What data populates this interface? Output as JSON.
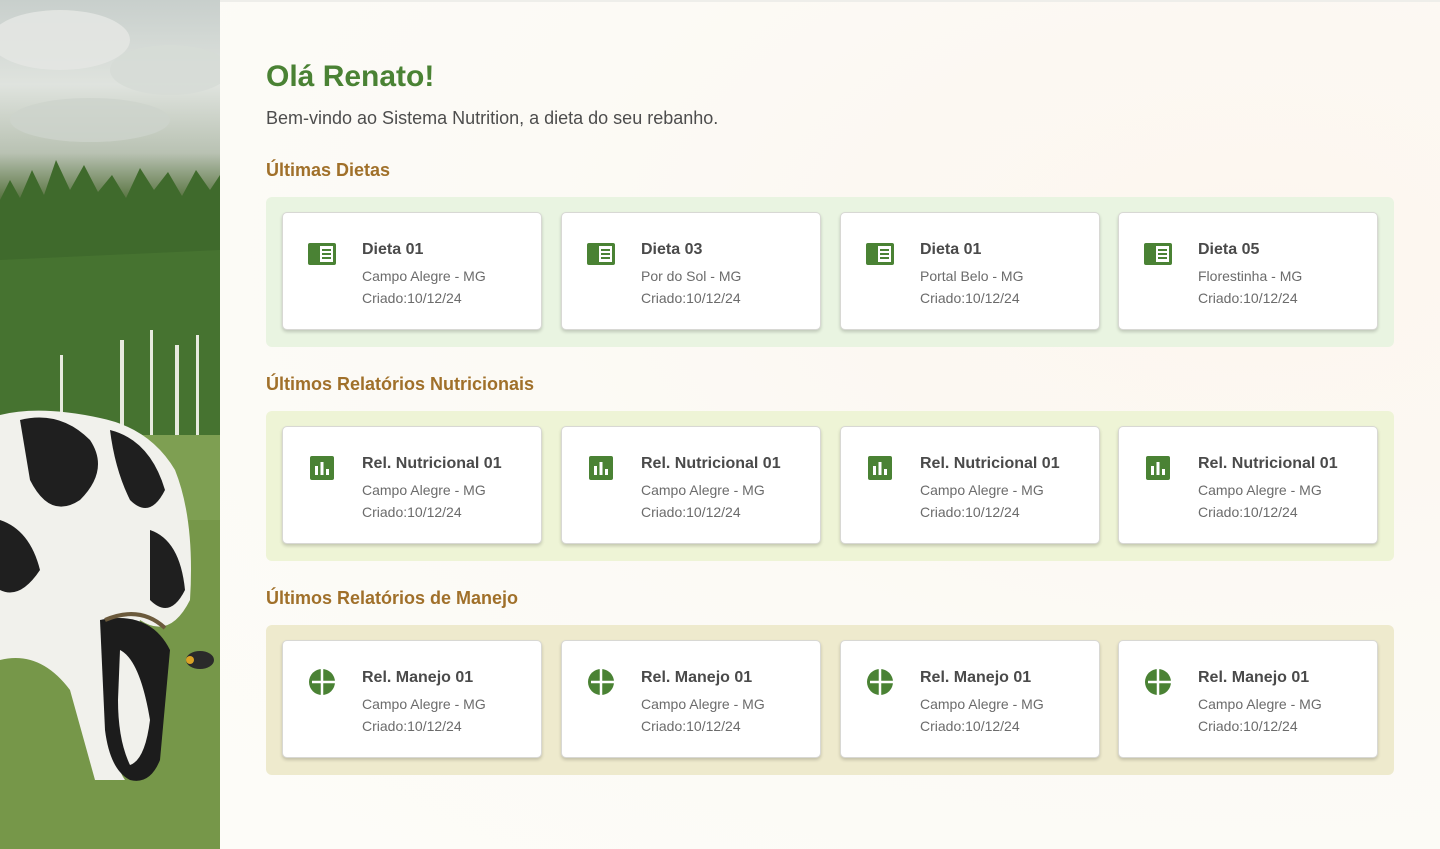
{
  "greeting": "Olá Renato!",
  "subtitle": "Bem-vindo ao Sistema Nutrition, a dieta do seu rebanho.",
  "colors": {
    "primary_green": "#4a8234",
    "section_title": "#a0702a",
    "panel_diets": "#e9f4e1",
    "panel_nutritional": "#eef4d6",
    "panel_management": "#eeeacd"
  },
  "sections": [
    {
      "title": "Últimas Dietas",
      "icon": "book-icon",
      "cards": [
        {
          "title": "Dieta 01",
          "location": "Campo Alegre - MG",
          "date": "Criado:10/12/24"
        },
        {
          "title": "Dieta 03",
          "location": "Por do Sol - MG",
          "date": "Criado:10/12/24"
        },
        {
          "title": "Dieta 01",
          "location": "Portal Belo - MG",
          "date": "Criado:10/12/24"
        },
        {
          "title": "Dieta 05",
          "location": "Florestinha - MG",
          "date": "Criado:10/12/24"
        }
      ]
    },
    {
      "title": "Últimos Relatórios Nutricionais",
      "icon": "bar-chart-icon",
      "cards": [
        {
          "title": "Rel. Nutricional 01",
          "location": "Campo Alegre - MG",
          "date": "Criado:10/12/24"
        },
        {
          "title": "Rel. Nutricional 01",
          "location": "Campo Alegre - MG",
          "date": "Criado:10/12/24"
        },
        {
          "title": "Rel. Nutricional 01",
          "location": "Campo Alegre - MG",
          "date": "Criado:10/12/24"
        },
        {
          "title": "Rel. Nutricional 01",
          "location": "Campo Alegre - MG",
          "date": "Criado:10/12/24"
        }
      ]
    },
    {
      "title": "Últimos Relatórios de Manejo",
      "icon": "pie-chart-icon",
      "cards": [
        {
          "title": "Rel. Manejo 01",
          "location": "Campo Alegre - MG",
          "date": "Criado:10/12/24"
        },
        {
          "title": "Rel. Manejo 01",
          "location": "Campo Alegre - MG",
          "date": "Criado:10/12/24"
        },
        {
          "title": "Rel. Manejo 01",
          "location": "Campo Alegre - MG",
          "date": "Criado:10/12/24"
        },
        {
          "title": "Rel. Manejo 01",
          "location": "Campo Alegre - MG",
          "date": "Criado:10/12/24"
        }
      ]
    }
  ]
}
